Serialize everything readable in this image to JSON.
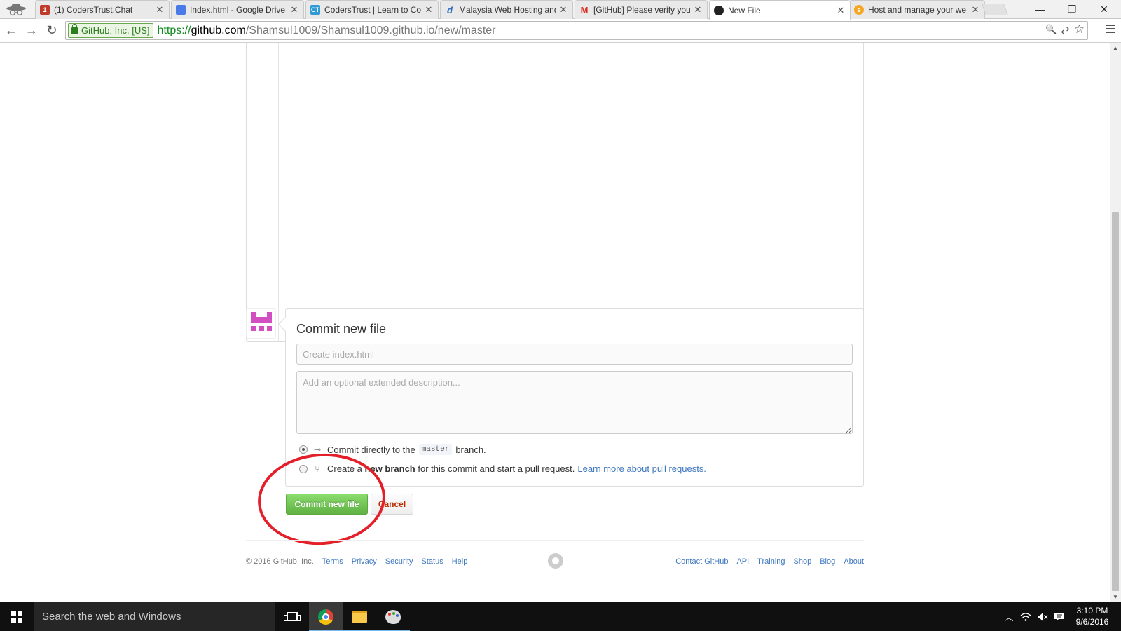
{
  "browser": {
    "tabs": [
      {
        "title": "(1) CodersTrust.Chat",
        "favicon": "coderstrust-chat-icon",
        "color": "#c0392b",
        "glyph": "1",
        "active": false
      },
      {
        "title": "Index.html - Google Drive",
        "favicon": "google-docs-icon",
        "color": "#4a7ae8",
        "glyph": "",
        "active": false
      },
      {
        "title": "CodersTrust | Learn to Cod",
        "favicon": "coderstrust-icon",
        "color": "#2f9bd6",
        "glyph": "CT",
        "active": false
      },
      {
        "title": "Malaysia Web Hosting and",
        "favicon": "dreamhost-icon",
        "color": "#ffffff",
        "glyph": "d",
        "active": false
      },
      {
        "title": "[GitHub] Please verify your",
        "favicon": "gmail-icon",
        "color": "#ffffff",
        "glyph": "M",
        "active": false
      },
      {
        "title": "New File",
        "favicon": "github-icon",
        "color": "#222222",
        "glyph": "",
        "active": true
      },
      {
        "title": "Host and manage your we",
        "favicon": "orange-circle-icon",
        "color": "#f5a623",
        "glyph": "e",
        "active": false
      }
    ],
    "window_controls": {
      "minimize": "—",
      "restore": "❐",
      "close": "✕"
    },
    "nav": {
      "back": "←",
      "forward": "→",
      "reload": "↻"
    },
    "security_badge": "GitHub, Inc. [US]",
    "url": {
      "scheme": "https://",
      "host": "github.com",
      "path": "/Shamsul1009/Shamsul1009.github.io/new/master"
    },
    "omnibox_icons": {
      "zoom": "🔍",
      "translate": "⇄",
      "star": "☆"
    }
  },
  "commit": {
    "title": "Commit new file",
    "summary_placeholder": "Create index.html",
    "description_placeholder": "Add an optional extended description...",
    "option_direct": {
      "prefix": "Commit directly to the",
      "branch": "master",
      "suffix": "branch."
    },
    "option_new_branch": {
      "prefix": "Create a",
      "bold": "new branch",
      "suffix": "for this commit and start a pull request.",
      "link": "Learn more about pull requests."
    },
    "submit_label": "Commit new file",
    "cancel_label": "Cancel",
    "accent_color": "#60b044"
  },
  "footer": {
    "copyright": "© 2016 GitHub, Inc.",
    "left_links": [
      "Terms",
      "Privacy",
      "Security",
      "Status",
      "Help"
    ],
    "right_links": [
      "Contact GitHub",
      "API",
      "Training",
      "Shop",
      "Blog",
      "About"
    ]
  },
  "taskbar": {
    "search_placeholder": "Search the web and Windows",
    "apps": [
      "task-view-icon",
      "chrome-icon",
      "file-explorer-icon",
      "paint-icon"
    ],
    "tray": {
      "chevron": "^",
      "network": "wifi-icon",
      "volume": "muted-speaker-icon",
      "notifications": "action-center-icon"
    },
    "time": "3:10 PM",
    "date": "9/6/2016"
  }
}
